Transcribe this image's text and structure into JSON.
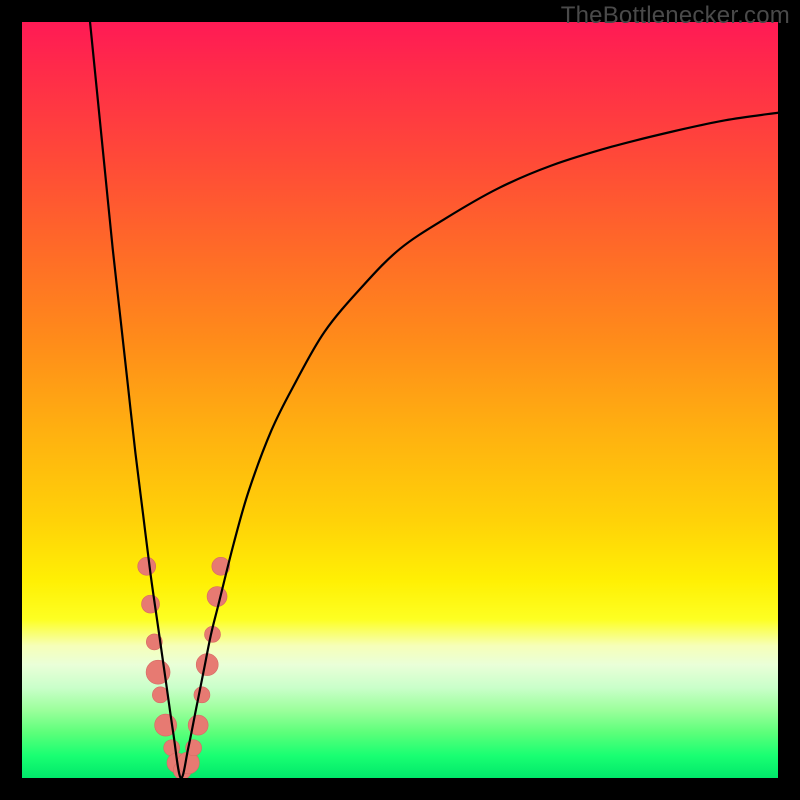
{
  "domain": "Chart",
  "watermark_text": "TheBottlenecker.com",
  "colors": {
    "frame": "#000000",
    "curve": "#000000",
    "dot_fill": "#e77a72",
    "dot_stroke": "#d66a63",
    "gradient_top": "#ff1a55",
    "gradient_bottom": "#00e86a"
  },
  "chart_data": {
    "type": "line",
    "title": "",
    "xlabel": "",
    "ylabel": "",
    "x_range": [
      0,
      100
    ],
    "y_range": [
      0,
      100
    ],
    "x_axis_note": "implicit hardware-scale axis (no tick labels rendered)",
    "y_axis_note": "bottleneck percentage 0 (bottom/green) to 100 (top/red)",
    "curve": {
      "description": "V-shaped bottleneck curve; minimum near x≈21, left branch steep, right branch rises asymptotically toward ~88%",
      "min_x": 21,
      "min_y": 0,
      "left_branch_top_x": 9,
      "left_branch_top_y": 100,
      "right_branch_end_x": 100,
      "right_branch_end_y": 88
    },
    "series": [
      {
        "name": "bottleneck-curve",
        "x": [
          9,
          10,
          11,
          12,
          13,
          14,
          15,
          16,
          17,
          18,
          19,
          20,
          21,
          22,
          23,
          24,
          25,
          26,
          28,
          30,
          33,
          36,
          40,
          45,
          50,
          56,
          63,
          70,
          78,
          86,
          93,
          100
        ],
        "y": [
          100,
          90,
          80,
          70,
          61,
          52,
          43,
          35,
          27,
          20,
          13,
          6,
          0,
          4,
          9,
          14,
          19,
          23,
          31,
          38,
          46,
          52,
          59,
          65,
          70,
          74,
          78,
          81,
          83.5,
          85.5,
          87,
          88
        ]
      }
    ],
    "scatter_points": {
      "name": "sample-dots",
      "note": "pink dots clustered on both sides of the curve minimum, roughly y ∈ [1, 28]",
      "points": [
        {
          "x": 16.5,
          "y": 28,
          "r": 9
        },
        {
          "x": 17.0,
          "y": 23,
          "r": 9
        },
        {
          "x": 17.5,
          "y": 18,
          "r": 8
        },
        {
          "x": 18.0,
          "y": 14,
          "r": 12
        },
        {
          "x": 18.3,
          "y": 11,
          "r": 8
        },
        {
          "x": 19.0,
          "y": 7,
          "r": 11
        },
        {
          "x": 19.8,
          "y": 4,
          "r": 8
        },
        {
          "x": 20.5,
          "y": 2,
          "r": 10
        },
        {
          "x": 21.2,
          "y": 1,
          "r": 9
        },
        {
          "x": 22.0,
          "y": 2,
          "r": 11
        },
        {
          "x": 22.7,
          "y": 4,
          "r": 8
        },
        {
          "x": 23.3,
          "y": 7,
          "r": 10
        },
        {
          "x": 23.8,
          "y": 11,
          "r": 8
        },
        {
          "x": 24.5,
          "y": 15,
          "r": 11
        },
        {
          "x": 25.2,
          "y": 19,
          "r": 8
        },
        {
          "x": 25.8,
          "y": 24,
          "r": 10
        },
        {
          "x": 26.3,
          "y": 28,
          "r": 9
        }
      ]
    }
  }
}
